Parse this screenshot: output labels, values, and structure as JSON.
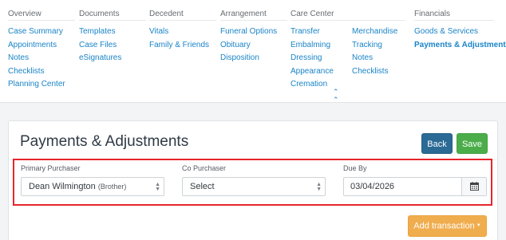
{
  "nav": {
    "overview": {
      "heading": "Overview",
      "links": [
        "Case Summary",
        "Appointments",
        "Notes",
        "Checklists",
        "Planning Center"
      ]
    },
    "documents": {
      "heading": "Documents",
      "links": [
        "Templates",
        "Case Files",
        "eSignatures"
      ]
    },
    "decedent": {
      "heading": "Decedent",
      "links": [
        "Vitals",
        "Family & Friends"
      ]
    },
    "arrangement": {
      "heading": "Arrangement",
      "links": [
        "Funeral Options",
        "Obituary",
        "Disposition"
      ]
    },
    "care_center": {
      "heading": "Care Center",
      "links": [
        "Transfer",
        "Embalming",
        "Dressing",
        "Appearance",
        "Cremation"
      ]
    },
    "care_center_2": {
      "links": [
        "Merchandise",
        "Tracking",
        "Notes",
        "Checklists"
      ]
    },
    "financials": {
      "heading": "Financials",
      "links": [
        "Goods & Services",
        "Payments & Adjustments"
      ]
    },
    "collapse_icon": "double-chevron-up-icon",
    "accent": "#1a84c7"
  },
  "page": {
    "title": "Payments & Adjustments",
    "back_label": "Back",
    "save_label": "Save",
    "add_transaction_label": "Add transaction",
    "colors": {
      "back": "#2a6a95",
      "save": "#4bad4a",
      "add": "#f0ad4e",
      "highlight": "#e5252c"
    }
  },
  "form": {
    "primary_purchaser": {
      "label": "Primary Purchaser",
      "value": "Dean Wilmington",
      "relation": "(Brother)"
    },
    "co_purchaser": {
      "label": "Co Purchaser",
      "value": "Select"
    },
    "due_by": {
      "label": "Due By",
      "value": "03/04/2026",
      "icon": "calendar-icon"
    }
  }
}
